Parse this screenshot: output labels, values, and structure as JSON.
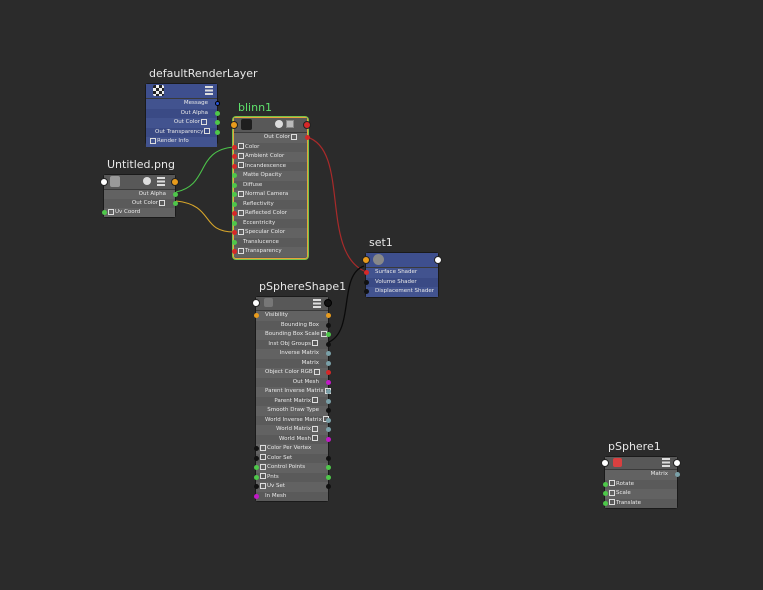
{
  "colors": {
    "background": "#2b2b2b",
    "node_gray": "#5b5b5b",
    "node_blue": "#3e4f8e",
    "selected_outline": "#e8a33a",
    "port_green": "#4ec74a",
    "port_red": "#d62828",
    "port_blue": "#2a55d8",
    "port_magenta": "#c218c8",
    "port_orange": "#e89b1c",
    "wire_red": "#a82a2a",
    "wire_green": "#4cc24a",
    "wire_yellow": "#d8a62a",
    "wire_black": "#0a0a0a"
  },
  "nodes": {
    "defaultRenderLayer": {
      "title": "defaultRenderLayer",
      "icon": "render-layer-checker-icon",
      "rows": [
        "Message",
        "Out Alpha",
        "Out Color",
        "Out Transparency",
        "Render Info"
      ]
    },
    "untitled": {
      "title": "Untitled.png",
      "icon": "file-texture-icon",
      "rows": [
        "Out Alpha",
        "Out Color",
        "Uv Coord"
      ]
    },
    "blinn1": {
      "title": "blinn1",
      "icon": "blinn-material-icon",
      "rows": [
        "Out Color",
        "Color",
        "Ambient Color",
        "Incandescence",
        "Matte Opacity",
        "Diffuse",
        "Normal Camera",
        "Reflectivity",
        "Reflected Color",
        "Eccentricity",
        "Specular Color",
        "Translucence",
        "Transparency"
      ]
    },
    "set1": {
      "title": "set1",
      "icon": "shading-group-icon",
      "rows": [
        "Surface Shader",
        "Volume Shader",
        "Displacement Shader"
      ]
    },
    "pSphereShape1": {
      "title": "pSphereShape1",
      "icon": "mesh-shape-icon",
      "rows": [
        "Visibility",
        "Bounding Box",
        "Bounding Box Scale",
        "Inst Obj Groups",
        "Inverse Matrix",
        "Matrix",
        "Object Color RGB",
        "Out Mesh",
        "Parent Inverse Matrix",
        "Parent Matrix",
        "Smooth Draw Type",
        "World Inverse Matrix",
        "World Matrix",
        "World Mesh",
        "Color Per Vertex",
        "Color Set",
        "Control Points",
        "Pnts",
        "Uv Set",
        "In Mesh"
      ]
    },
    "pSphere1": {
      "title": "pSphere1",
      "icon": "transform-icon",
      "rows": [
        "Matrix",
        "Rotate",
        "Scale",
        "Translate"
      ]
    }
  }
}
